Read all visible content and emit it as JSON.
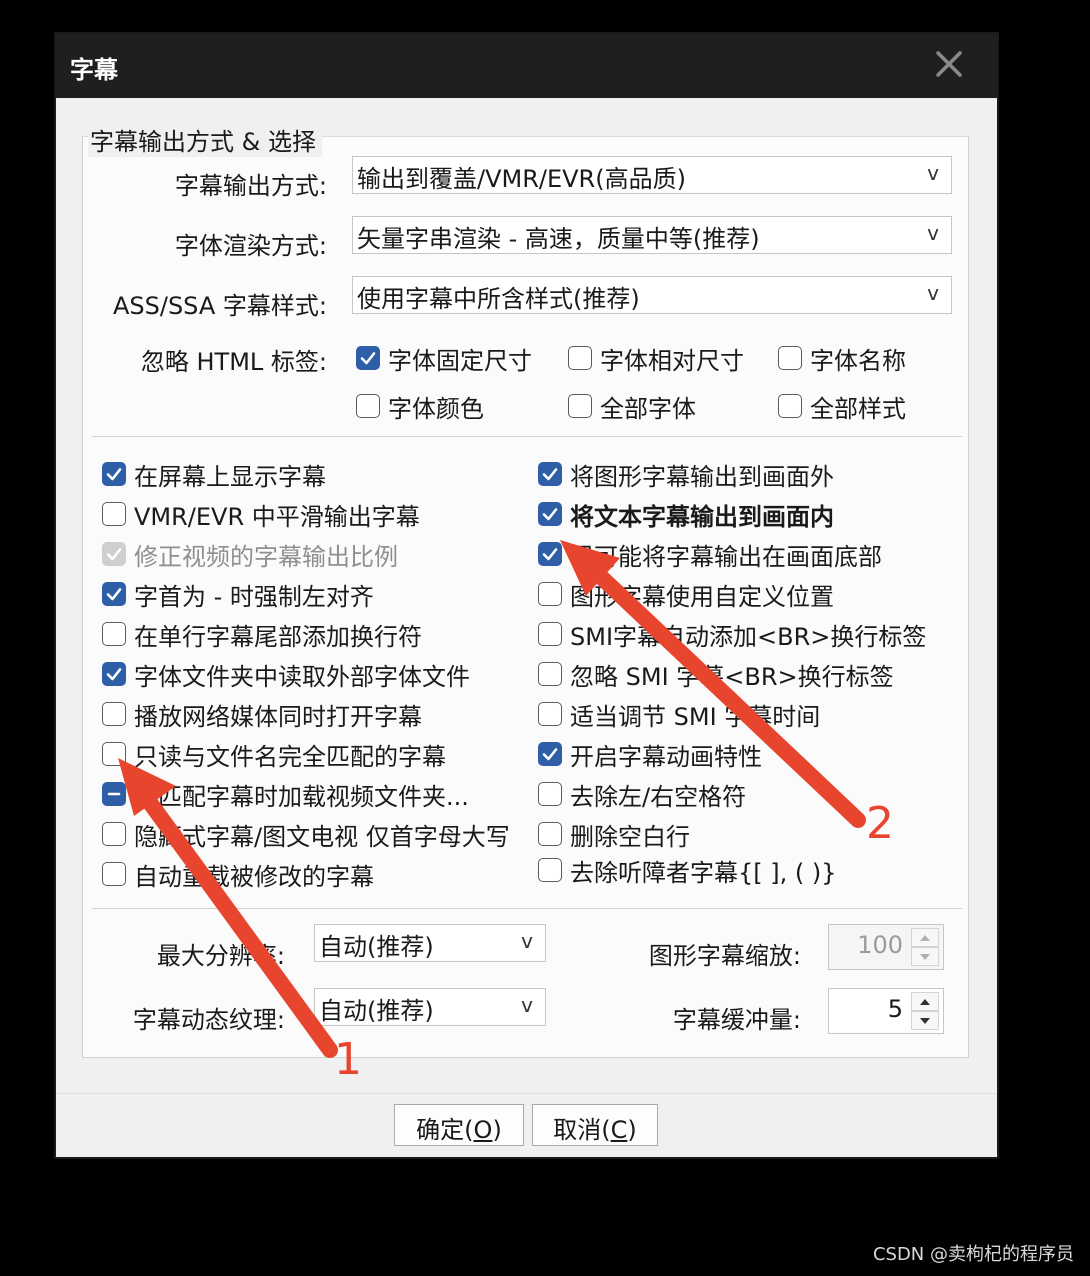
{
  "window": {
    "title": "字幕"
  },
  "group": {
    "title": "字幕输出方式 & 选择"
  },
  "settings": [
    {
      "label": "字幕输出方式:",
      "value": "输出到覆盖/VMR/EVR(高品质)"
    },
    {
      "label": "字体渲染方式:",
      "value": "矢量字串渲染 - 高速，质量中等(推荐)"
    },
    {
      "label": "ASS/SSA 字幕样式:",
      "value": "使用字幕中所含样式(推荐)"
    }
  ],
  "ignore_html": {
    "label": "忽略 HTML 标签:",
    "options": [
      {
        "label": "字体固定尺寸",
        "checked": true
      },
      {
        "label": "字体相对尺寸",
        "checked": false
      },
      {
        "label": "字体名称",
        "checked": false
      },
      {
        "label": "字体颜色",
        "checked": false
      },
      {
        "label": "全部字体",
        "checked": false
      },
      {
        "label": "全部样式",
        "checked": false
      }
    ]
  },
  "left_options": [
    {
      "label": "在屏幕上显示字幕",
      "state": "checked"
    },
    {
      "label": "VMR/EVR 中平滑输出字幕",
      "state": "unchecked"
    },
    {
      "label": "修正视频的字幕输出比例",
      "state": "disabled"
    },
    {
      "label": "字首为 - 时强制左对齐",
      "state": "checked"
    },
    {
      "label": "在单行字幕尾部添加换行符",
      "state": "unchecked"
    },
    {
      "label": "字体文件夹中读取外部字体文件",
      "state": "checked"
    },
    {
      "label": "播放网络媒体同时打开字幕",
      "state": "unchecked"
    },
    {
      "label": "只读与文件名完全匹配的字幕",
      "state": "unchecked"
    },
    {
      "label": "有匹配字幕时加载视频文件夹...",
      "state": "indeterminate"
    },
    {
      "label": "隐藏式字幕/图文电视 仅首字母大写",
      "state": "unchecked"
    },
    {
      "label": "自动重载被修改的字幕",
      "state": "unchecked"
    }
  ],
  "right_options": [
    {
      "label": "将图形字幕输出到画面外",
      "state": "checked"
    },
    {
      "label": "将文本字幕输出到画面内",
      "state": "checked",
      "bold": true
    },
    {
      "label": "尽可能将字幕输出在画面底部",
      "state": "checked"
    },
    {
      "label": "图形字幕使用自定义位置",
      "state": "unchecked"
    },
    {
      "label": "SMI字幕自动添加<BR>换行标签",
      "state": "unchecked"
    },
    {
      "label": "忽略 SMI 字幕<BR>换行标签",
      "state": "unchecked"
    },
    {
      "label": "适当调节 SMI 字幕时间",
      "state": "unchecked"
    },
    {
      "label": "开启字幕动画特性",
      "state": "checked"
    },
    {
      "label": "去除左/右空格符",
      "state": "unchecked"
    },
    {
      "label": "删除空白行",
      "state": "unchecked"
    },
    {
      "label": "去除听障者字幕{[ ], ( )}",
      "state": "unchecked"
    }
  ],
  "bottom": {
    "max_resolution": {
      "label": "最大分辨率:",
      "value": "自动(推荐)"
    },
    "dynamic_texture": {
      "label": "字幕动态纹理:",
      "value": "自动(推荐)"
    },
    "graphic_zoom": {
      "label": "图形字幕缩放:",
      "value": "100"
    },
    "buffer": {
      "label": "字幕缓冲量:",
      "value": "5"
    }
  },
  "buttons": {
    "ok": {
      "text": "确定(",
      "key": "O",
      "end": ")"
    },
    "cancel": {
      "text": "取消(",
      "key": "C",
      "end": ")"
    }
  },
  "dropdown_arrow": "v",
  "annotations": {
    "arrow1_label": "1",
    "arrow2_label": "2",
    "arrow_color": "#e8452f"
  },
  "watermark": "CSDN @卖枸杞的程序员"
}
